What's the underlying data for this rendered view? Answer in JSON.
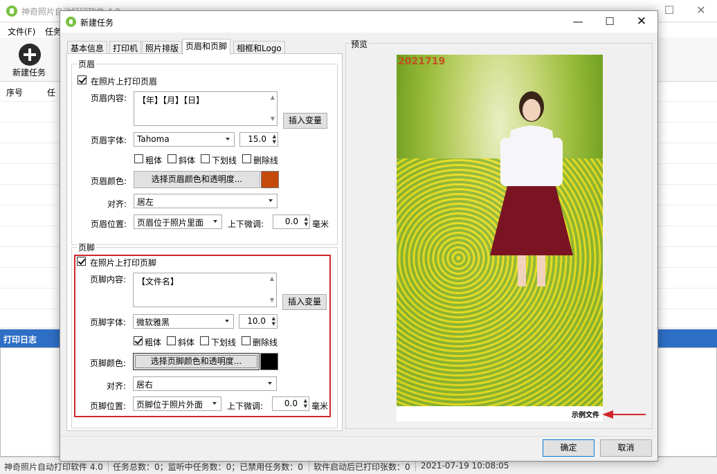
{
  "main_window": {
    "title": "神奇照片自动打印软件 4.0",
    "menu": [
      "文件(F)",
      "任务"
    ],
    "toolbar": {
      "new_task_label": "新建任务"
    },
    "table_headers": [
      "序号",
      "任"
    ],
    "log_title": "打印日志",
    "status": {
      "app": "神奇照片自动打印软件 4.0",
      "task_count": "任务总数：0；监听中任务数：0；已禁用任务数：0",
      "printed_since_start": "软件启动后已打印张数：0",
      "datetime": "2021-07-19 10:08:05"
    }
  },
  "dialog": {
    "title": "新建任务",
    "tabs": [
      "基本信息",
      "打印机",
      "照片排版",
      "页眉和页脚",
      "相框和Logo"
    ],
    "active_tab": "页眉和页脚",
    "header": {
      "group_title": "页眉",
      "enable_label": "在照片上打印页眉",
      "enabled": true,
      "content_label": "页眉内容:",
      "content_value": "【年】【月】【日】",
      "insert_var_label": "插入变量",
      "font_label": "页眉字体:",
      "font_value": "Tahoma",
      "size_value": "15.0",
      "bold_label": "粗体",
      "bold": false,
      "italic_label": "斜体",
      "italic": false,
      "underline_label": "下划线",
      "underline": false,
      "strike_label": "删除线",
      "strike": false,
      "color_label": "页眉颜色:",
      "color_button": "选择页眉颜色和透明度...",
      "color_value": "#c44a0c",
      "align_label": "对齐:",
      "align_value": "居左",
      "position_label": "页眉位置:",
      "position_value": "页眉位于照片里面",
      "adjust_label": "上下微调:",
      "adjust_value": "0.0",
      "unit": "毫米"
    },
    "footer": {
      "group_title": "页脚",
      "enable_label": "在照片上打印页脚",
      "enabled": true,
      "content_label": "页脚内容:",
      "content_value": "【文件名】",
      "insert_var_label": "插入变量",
      "font_label": "页脚字体:",
      "font_value": "微软雅黑",
      "size_value": "10.0",
      "bold_label": "粗体",
      "bold": true,
      "italic_label": "斜体",
      "italic": false,
      "underline_label": "下划线",
      "underline": false,
      "strike_label": "删除线",
      "strike": false,
      "color_label": "页脚颜色:",
      "color_button": "选择页脚颜色和透明度...",
      "color_value": "#000000",
      "align_label": "对齐:",
      "align_value": "居右",
      "position_label": "页脚位置:",
      "position_value": "页脚位于照片外面",
      "adjust_label": "上下微调:",
      "adjust_value": "0.0",
      "unit": "毫米"
    },
    "preview": {
      "title": "预览",
      "header_text": "2021719",
      "footer_text": "示例文件"
    },
    "ok_label": "确定",
    "cancel_label": "取消"
  },
  "colors": {
    "accent_blue": "#2e6fc6",
    "highlight_red": "#d0262a",
    "header_text": "#c0501e"
  }
}
